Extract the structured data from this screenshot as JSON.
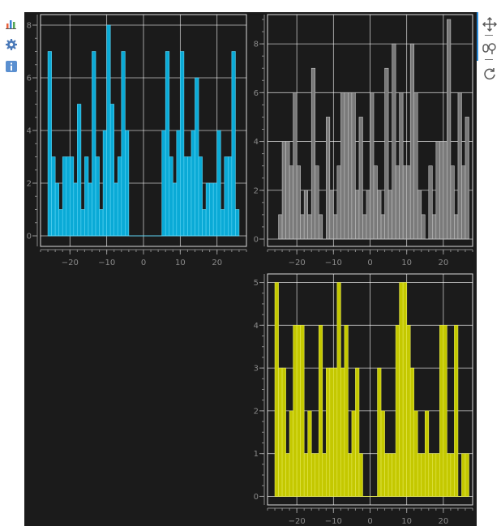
{
  "sidebar": {
    "icons": [
      {
        "name": "bar-chart-icon"
      },
      {
        "name": "gear-icon"
      },
      {
        "name": "info-icon"
      }
    ]
  },
  "toolbar": {
    "tools": [
      {
        "name": "pan-tool-icon"
      },
      {
        "name": "box-zoom-tool-icon"
      },
      {
        "name": "reset-tool-icon"
      }
    ]
  },
  "colors": {
    "panel_background": "#1b1b1b",
    "grid": "#ffffff",
    "tick_text": "#8a8a8a"
  },
  "chart_data": [
    {
      "type": "bar",
      "title": "",
      "xlabel": "",
      "ylabel": "",
      "color": "#0aaad6",
      "bar_stroke": "#5fd6f5",
      "xlim": [
        -28,
        28
      ],
      "ylim": [
        -0.4,
        8.4
      ],
      "xticks": [
        -20,
        -10,
        0,
        10,
        20
      ],
      "yticks": [
        0,
        2,
        4,
        6,
        8
      ],
      "grid": true,
      "bin_width": 1,
      "bin_start": -26,
      "values": [
        7,
        3,
        2,
        1,
        3,
        3,
        3,
        2,
        5,
        1,
        3,
        2,
        7,
        3,
        1,
        4,
        8,
        5,
        2,
        3,
        7,
        4,
        0,
        0,
        0,
        0,
        0,
        0,
        0,
        0,
        0,
        4,
        7,
        3,
        2,
        4,
        7,
        3,
        3,
        4,
        6,
        3,
        1,
        2,
        2,
        2,
        4,
        1,
        3,
        3,
        7,
        1
      ]
    },
    {
      "type": "bar",
      "title": "",
      "xlabel": "",
      "ylabel": "",
      "color": "#7a7a7a",
      "bar_stroke": "#c2c2c2",
      "xlim": [
        -28,
        28
      ],
      "ylim": [
        -0.3,
        9.2
      ],
      "xticks": [
        -20,
        -10,
        0,
        10,
        20
      ],
      "yticks": [
        0,
        2,
        4,
        6,
        8
      ],
      "grid": true,
      "bin_width": 1,
      "bin_start": -25,
      "values": [
        1,
        4,
        4,
        3,
        6,
        3,
        1,
        2,
        1,
        7,
        3,
        1,
        0,
        5,
        2,
        1,
        3,
        6,
        6,
        6,
        6,
        2,
        5,
        1,
        2,
        6,
        3,
        2,
        1,
        7,
        2,
        8,
        3,
        6,
        3,
        3,
        8,
        6,
        2,
        1,
        0,
        3,
        1,
        4,
        4,
        4,
        9,
        3,
        1,
        6,
        3,
        5
      ]
    },
    {
      "type": "bar",
      "title": "",
      "xlabel": "",
      "ylabel": "",
      "color": "#c4c800",
      "bar_stroke": "#e6ea55",
      "xlim": [
        -28,
        28
      ],
      "ylim": [
        -0.2,
        5.2
      ],
      "xticks": [
        -20,
        -10,
        0,
        10,
        20
      ],
      "yticks": [
        0,
        1,
        2,
        3,
        4,
        5
      ],
      "grid": true,
      "bin_width": 1,
      "bin_start": -26,
      "values": [
        5,
        3,
        3,
        1,
        2,
        4,
        4,
        4,
        1,
        2,
        1,
        1,
        4,
        1,
        3,
        3,
        3,
        5,
        3,
        4,
        1,
        2,
        3,
        1,
        0,
        0,
        0,
        0,
        3,
        2,
        1,
        1,
        1,
        4,
        5,
        5,
        4,
        3,
        2,
        1,
        1,
        2,
        1,
        1,
        1,
        4,
        4,
        1,
        1,
        4,
        0,
        1,
        1
      ]
    }
  ]
}
